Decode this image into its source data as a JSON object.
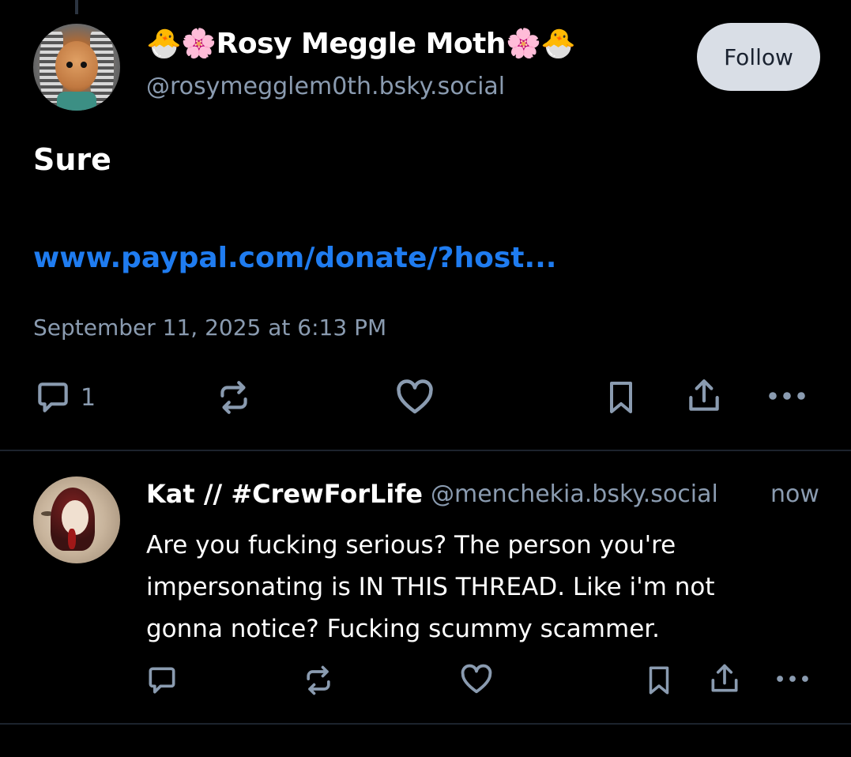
{
  "main_post": {
    "display_name": "🐣🌸Rosy Meggle Moth🌸🐣",
    "handle": "@rosymegglem0th.bsky.social",
    "follow_label": "Follow",
    "text": "Sure",
    "link_text": "www.paypal.com/donate/?host...",
    "timestamp": "September 11, 2025 at 6:13 PM",
    "actions": {
      "reply_icon": "reply-icon",
      "reply_count": "1",
      "repost_icon": "repost-icon",
      "like_icon": "heart-icon",
      "bookmark_icon": "bookmark-icon",
      "share_icon": "share-icon",
      "more_icon": "more-icon"
    }
  },
  "reply": {
    "display_name": "Kat // #CrewForLife",
    "handle": "@menchekia.bsky.social",
    "time": "now",
    "text": "Are you fucking serious?  The person you're impersonating is IN THIS THREAD.  Like i'm not gonna notice?  Fucking scummy scammer.",
    "actions": {
      "reply_icon": "reply-icon",
      "repost_icon": "repost-icon",
      "like_icon": "heart-icon",
      "bookmark_icon": "bookmark-icon",
      "share_icon": "share-icon",
      "more_icon": "more-icon"
    }
  },
  "colors": {
    "background": "#000000",
    "text_primary": "#ffffff",
    "text_secondary": "#8a9bb0",
    "link": "#1f7cf0",
    "follow_bg": "#d9dee6",
    "divider": "#1c232d"
  }
}
